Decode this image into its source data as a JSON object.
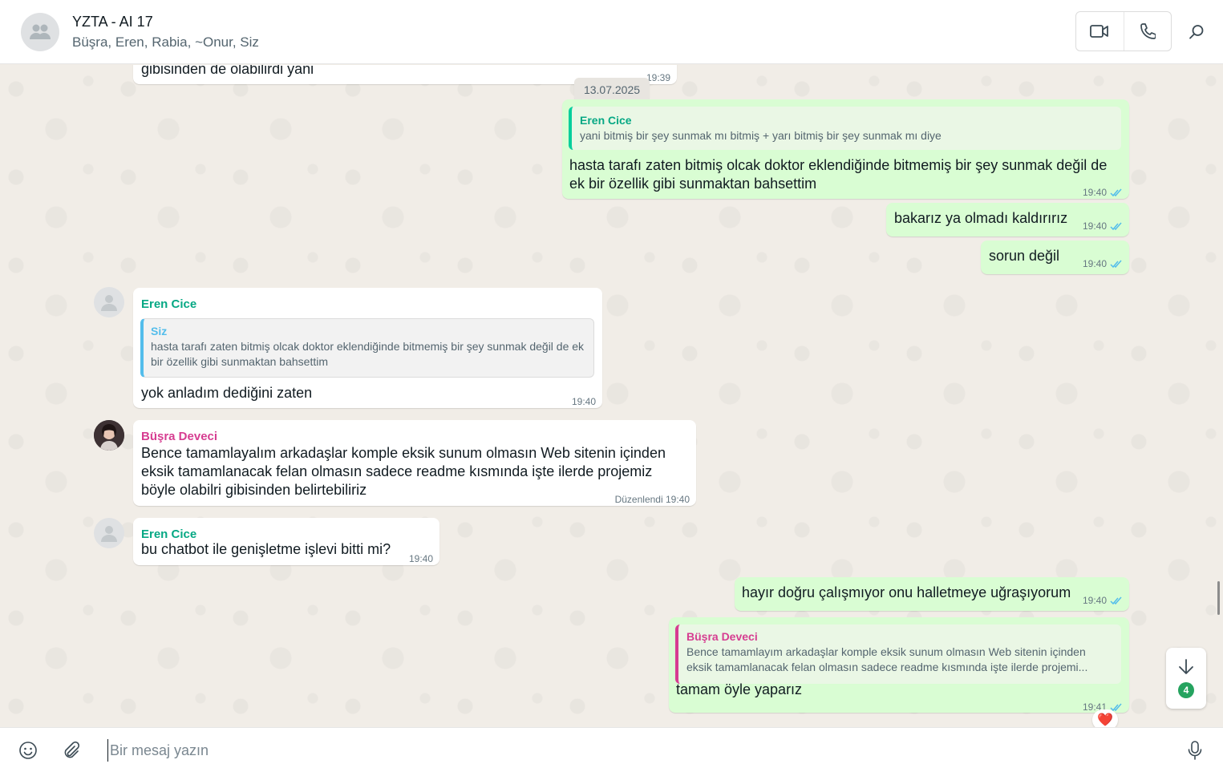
{
  "header": {
    "title": "YZTA - AI 17",
    "members": "Büşra, Eren, Rabia, ~Onur, Siz"
  },
  "chat": {
    "date_chip": "13.07.2025",
    "messages": [
      {
        "text": "gibisinden de olabilirdi yani",
        "time": "19:39"
      },
      {
        "quote_name": "Eren Cice",
        "quote_text": "yani bitmiş bir şey sunmak mı bitmiş + yarı bitmiş bir şey sunmak mı diye",
        "text": "hasta tarafı zaten bitmiş olcak doktor eklendiğinde bitmemiş bir şey sunmak değil de ek bir özellik gibi sunmaktan bahsettim",
        "time": "19:40"
      },
      {
        "text": "bakarız ya olmadı kaldırırız",
        "time": "19:40"
      },
      {
        "text": "sorun değil",
        "time": "19:40"
      },
      {
        "sender": "Eren Cice",
        "quote_name": "Siz",
        "quote_text": "hasta tarafı zaten bitmiş olcak doktor eklendiğinde bitmemiş bir şey sunmak değil de ek bir özellik gibi sunmaktan bahsettim",
        "text": "yok anladım dediğini zaten",
        "time": "19:40"
      },
      {
        "sender": "Büşra Deveci",
        "text": "Bence tamamlayalım arkadaşlar komple eksik sunum olmasın Web sitenin içinden eksik tamamlanacak felan olmasın sadece readme kısmında işte ilerde projemiz böyle olabilri gibisinden belirtebiliriz",
        "time": "Düzenlendi 19:40"
      },
      {
        "sender": "Eren Cice",
        "text": "bu chatbot ile genişletme işlevi bitti mi?",
        "time": "19:40"
      },
      {
        "text": "hayır doğru çalışmıyor onu halletmeye uğraşıyorum",
        "time": "19:40"
      },
      {
        "quote_name": "Büşra Deveci",
        "quote_text": "Bence tamamlayım arkadaşlar komple eksik sunum olmasın Web sitenin içinden eksik tamamlanacak felan olmasın sadece readme kısmında işte ilerde projemi...",
        "text": "tamam öyle yaparız",
        "time": "19:41",
        "reaction": "❤️"
      }
    ],
    "unread_count": "4"
  },
  "composer": {
    "placeholder": "Bir mesaj yazın"
  },
  "colors": {
    "outgoing_bubble": "#d9fdd3",
    "incoming_bubble": "#ffffff",
    "sender_eren": "#06a884",
    "sender_busra": "#d63d91",
    "read_tick": "#53bdeb",
    "badge": "#25a35f"
  },
  "icons": [
    "group-avatar-icon",
    "video-call-icon",
    "voice-call-icon",
    "search-icon",
    "double-check-icon",
    "arrow-down-icon",
    "emoji-icon",
    "attach-icon",
    "microphone-icon"
  ]
}
